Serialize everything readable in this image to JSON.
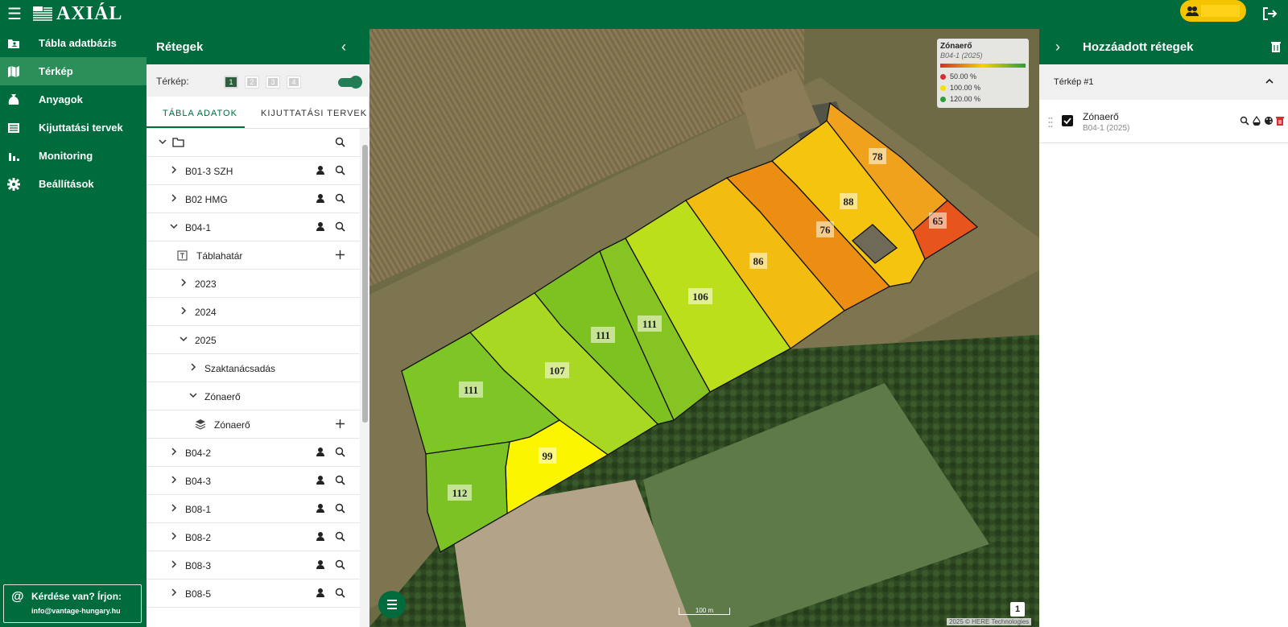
{
  "app": {
    "logo_text": "AXIÁL"
  },
  "nav": {
    "items": [
      {
        "label": "Tábla adatbázis",
        "icon": "folder-user-icon",
        "active": false
      },
      {
        "label": "Térkép",
        "icon": "map-icon",
        "active": true
      },
      {
        "label": "Anyagok",
        "icon": "sack-icon",
        "active": false
      },
      {
        "label": "Kijuttatási tervek",
        "icon": "list-icon",
        "active": false
      },
      {
        "label": "Monitoring",
        "icon": "bar-chart-icon",
        "active": false
      },
      {
        "label": "Beállítások",
        "icon": "gear-icon",
        "active": false
      }
    ],
    "help": {
      "title": "Kérdése van? Írjon:",
      "email": "info@vantage-hungary.hu"
    }
  },
  "layers_panel": {
    "title": "Rétegek",
    "map_label": "Térkép:",
    "map_numbers": [
      "1",
      "2",
      "3",
      "4"
    ],
    "active_map": "1",
    "sync_on": true,
    "tabs": [
      "TÁBLA ADATOK",
      "KIJUTTATÁSI TERVEK"
    ],
    "active_tab": 0,
    "tree": [
      {
        "label": "",
        "type": "root-folder",
        "level": 0,
        "expanded": true,
        "search": true,
        "add": false,
        "user": false
      },
      {
        "label": "B01-3 SZH",
        "level": 0,
        "expanded": false,
        "user": true,
        "search": true
      },
      {
        "label": "B02 HMG",
        "level": 0,
        "expanded": false,
        "user": true,
        "search": true
      },
      {
        "label": "B04-1",
        "level": 0,
        "expanded": true,
        "user": true,
        "search": true
      },
      {
        "label": "Táblahatár",
        "level": 1,
        "type": "boundary",
        "add": true
      },
      {
        "label": "2023",
        "level": 1,
        "expanded": false
      },
      {
        "label": "2024",
        "level": 1,
        "expanded": false
      },
      {
        "label": "2025",
        "level": 1,
        "expanded": true
      },
      {
        "label": "Szaktanácsadás",
        "level": 2,
        "expanded": false
      },
      {
        "label": "Zónaerő",
        "level": 2,
        "expanded": true
      },
      {
        "label": "Zónaerő",
        "level": 3,
        "type": "layer",
        "add": true
      },
      {
        "label": "B04-2",
        "level": 0,
        "expanded": false,
        "user": true,
        "search": true
      },
      {
        "label": "B04-3",
        "level": 0,
        "expanded": false,
        "user": true,
        "search": true
      },
      {
        "label": "B08-1",
        "level": 0,
        "expanded": false,
        "user": true,
        "search": true
      },
      {
        "label": "B08-2",
        "level": 0,
        "expanded": false,
        "user": true,
        "search": true
      },
      {
        "label": "B08-3",
        "level": 0,
        "expanded": false,
        "user": true,
        "search": true
      },
      {
        "label": "B08-5",
        "level": 0,
        "expanded": false,
        "user": true,
        "search": true
      }
    ]
  },
  "legend": {
    "title": "Zónaerő",
    "subtitle": "B04-1 (2025)",
    "items": [
      {
        "label": "50.00 %",
        "color": "#d32f2f"
      },
      {
        "label": "100.00 %",
        "color": "#f5e100"
      },
      {
        "label": "120.00 %",
        "color": "#2e9d3a"
      }
    ]
  },
  "zones": [
    {
      "value": "78",
      "color": "#f0a21c"
    },
    {
      "value": "65",
      "color": "#e8551c"
    },
    {
      "value": "88",
      "color": "#f5c40e"
    },
    {
      "value": "76",
      "color": "#ec8e12"
    },
    {
      "value": "86",
      "color": "#f3bc10"
    },
    {
      "value": "106",
      "color": "#bcdf1c"
    },
    {
      "value": "111",
      "color": "#86c424"
    },
    {
      "value": "111",
      "color": "#7ec222"
    },
    {
      "value": "107",
      "color": "#a8d822"
    },
    {
      "value": "111",
      "color": "#7ec626"
    },
    {
      "value": "99",
      "color": "#fbf600"
    },
    {
      "value": "112",
      "color": "#7cc224"
    }
  ],
  "map": {
    "scale_label": "100 m",
    "attribution": "2025 © HERE Technologies",
    "map_number": "1"
  },
  "right_panel": {
    "title": "Hozzáadott rétegek",
    "map_section": "Térkép #1",
    "layer": {
      "name": "Zónaerő",
      "sub": "B04-1 (2025)",
      "checked": true
    }
  },
  "colors": {
    "brand": "#006b3c",
    "accent": "#f5c400"
  }
}
